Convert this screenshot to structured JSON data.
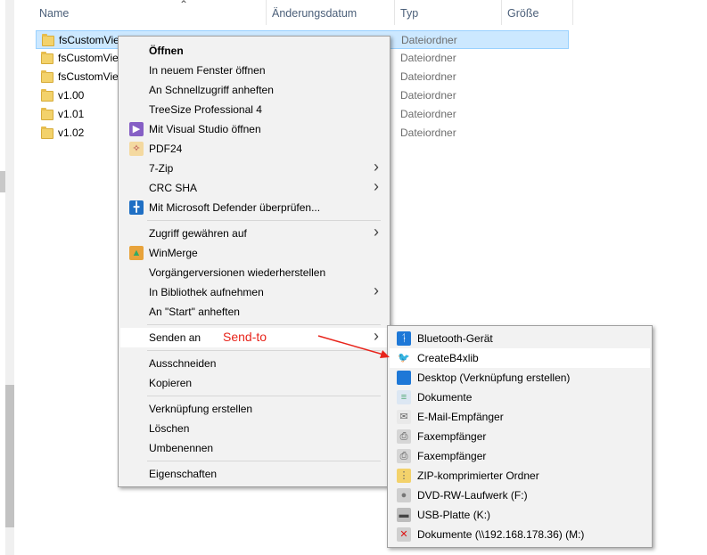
{
  "columns": {
    "name": "Name",
    "date": "Änderungsdatum",
    "type": "Typ",
    "size": "Größe"
  },
  "files": [
    {
      "name": "fsCustomVie",
      "type": "Dateiordner",
      "selected": true
    },
    {
      "name": "fsCustomVie",
      "type": "Dateiordner"
    },
    {
      "name": "fsCustomVie",
      "type": "Dateiordner"
    },
    {
      "name": "v1.00",
      "type": "Dateiordner"
    },
    {
      "name": "v1.01",
      "type": "Dateiordner"
    },
    {
      "name": "v1.02",
      "type": "Dateiordner"
    }
  ],
  "context_menu": {
    "items": [
      {
        "label": "Öffnen",
        "bold": true
      },
      {
        "label": "In neuem Fenster öffnen"
      },
      {
        "label": "An Schnellzugriff anheften"
      },
      {
        "label": "TreeSize Professional 4"
      },
      {
        "label": "Mit Visual Studio öffnen",
        "icon": "visual-studio-icon"
      },
      {
        "label": "PDF24",
        "icon": "pdf24-icon"
      },
      {
        "label": "7-Zip",
        "submenu": true
      },
      {
        "label": "CRC SHA",
        "submenu": true
      },
      {
        "label": "Mit Microsoft Defender überprüfen...",
        "icon": "defender-shield-icon"
      },
      {
        "label": "Zugriff gewähren auf",
        "submenu": true
      },
      {
        "label": "WinMerge",
        "icon": "winmerge-icon"
      },
      {
        "label": "Vorgängerversionen wiederherstellen"
      },
      {
        "label": "In Bibliothek aufnehmen",
        "submenu": true
      },
      {
        "label": "An \"Start\" anheften"
      },
      {
        "label": "Senden an",
        "submenu": true,
        "highlighted": true
      },
      {
        "label": "Ausschneiden"
      },
      {
        "label": "Kopieren"
      },
      {
        "label": "Verknüpfung erstellen"
      },
      {
        "label": "Löschen"
      },
      {
        "label": "Umbenennen"
      },
      {
        "label": "Eigenschaften"
      }
    ]
  },
  "sendto_menu": {
    "items": [
      {
        "label": "Bluetooth-Gerät",
        "icon": "bluetooth-icon"
      },
      {
        "label": "CreateB4xlib",
        "icon": "b4x-bird-icon",
        "highlighted": true
      },
      {
        "label": "Desktop (Verknüpfung erstellen)",
        "icon": "desktop-icon"
      },
      {
        "label": "Dokumente",
        "icon": "documents-icon"
      },
      {
        "label": "E-Mail-Empfänger",
        "icon": "mail-icon"
      },
      {
        "label": "Faxempfänger",
        "icon": "fax-icon"
      },
      {
        "label": "Faxempfänger",
        "icon": "fax-icon"
      },
      {
        "label": "ZIP-komprimierter Ordner",
        "icon": "zip-folder-icon"
      },
      {
        "label": "DVD-RW-Laufwerk (F:)",
        "icon": "dvd-drive-icon"
      },
      {
        "label": "USB-Platte (K:)",
        "icon": "usb-drive-icon"
      },
      {
        "label": "Dokumente (\\\\192.168.178.36) (M:)",
        "icon": "network-drive-icon"
      }
    ]
  },
  "annotation": {
    "text": "Send-to",
    "color": "#e8241b"
  },
  "colors": {
    "selection": "#cce8ff",
    "menu_bg": "#f2f2f2",
    "accent": "#0078d7"
  }
}
